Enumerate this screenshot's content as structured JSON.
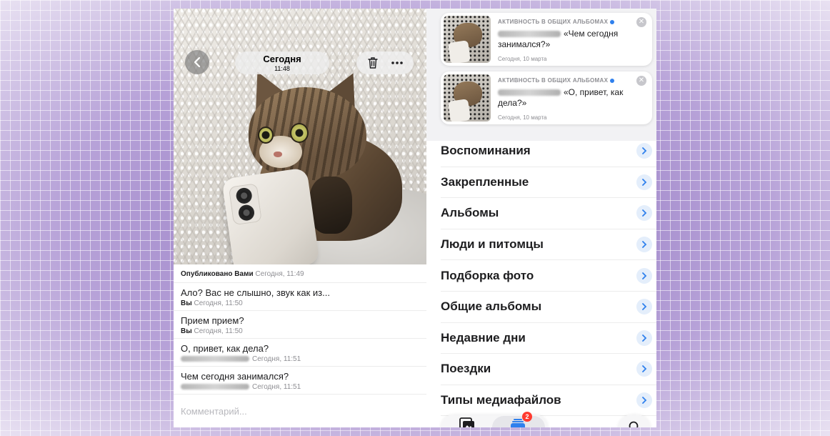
{
  "viewer": {
    "title": "Сегодня",
    "subtitle": "11:48",
    "published_by": "Опубликовано Вами",
    "published_time": "Сегодня, 11:49"
  },
  "comments": [
    {
      "text": "Ало? Вас не слышно, звук как из...",
      "author": "Вы",
      "time": "Сегодня, 11:50",
      "author_blurred": false
    },
    {
      "text": "Прием прием?",
      "author": "Вы",
      "time": "Сегодня, 11:50",
      "author_blurred": false
    },
    {
      "text": "О, привет, как дела?",
      "author": "",
      "time": "Сегодня, 11:51",
      "author_blurred": true
    },
    {
      "text": "Чем сегодня занимался?",
      "author": "",
      "time": "Сегодня, 11:51",
      "author_blurred": true
    }
  ],
  "comment_placeholder": "Комментарий...",
  "notifications": [
    {
      "title": "АКТИВНОСТЬ В ОБЩИХ АЛЬБОМАХ",
      "body": "«Чем сегодня занимался?»",
      "date": "Сегодня, 10 марта"
    },
    {
      "title": "АКТИВНОСТЬ В ОБЩИХ АЛЬБОМАХ",
      "body": "«О, привет, как дела?»",
      "date": "Сегодня, 10 марта"
    }
  ],
  "menu": [
    "Воспоминания",
    "Закрепленные",
    "Альбомы",
    "Люди и питомцы",
    "Подборка фото",
    "Общие альбомы",
    "Недавние дни",
    "Поездки",
    "Типы медиафайлов"
  ],
  "tabbar": {
    "badge_count": "2"
  },
  "colors": {
    "accent": "#2f80ed",
    "badge": "#ff3b30",
    "background": "#b9a6d6"
  },
  "icons": [
    "back-chevron-icon",
    "trash-icon",
    "more-icon",
    "close-icon",
    "chevron-right-icon",
    "library-icon",
    "collections-icon",
    "search-icon"
  ]
}
